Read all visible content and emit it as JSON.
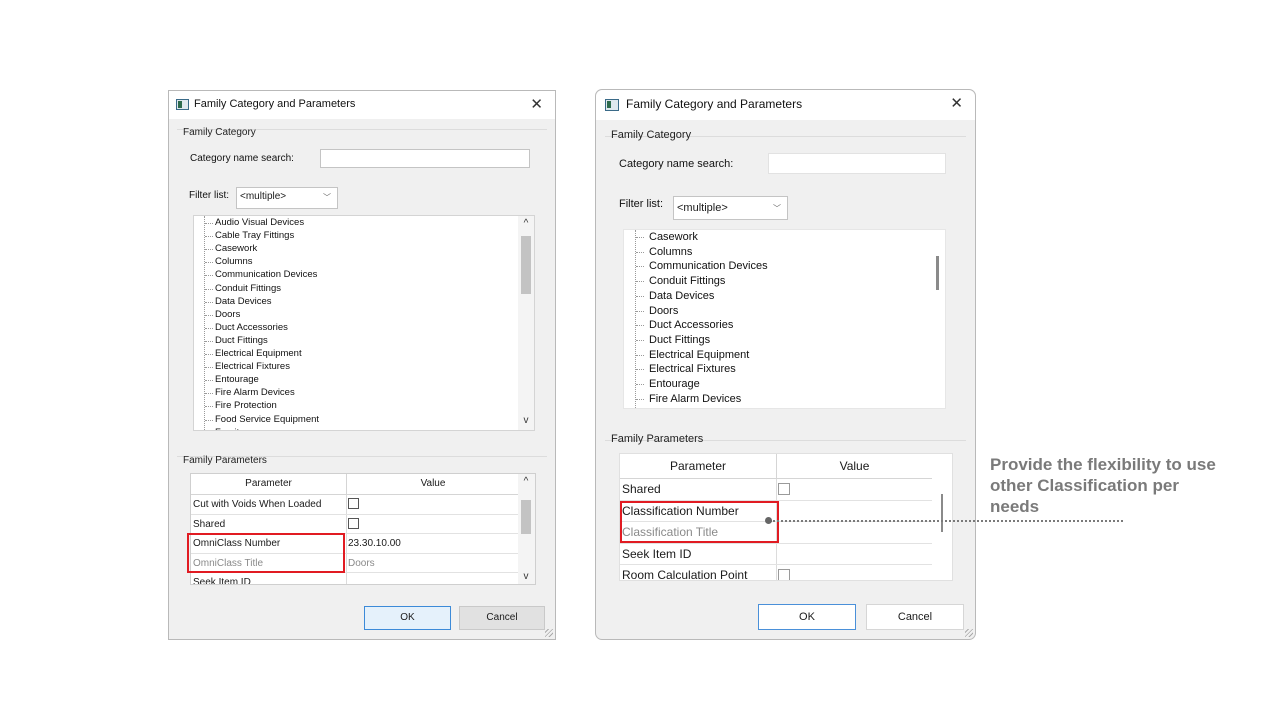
{
  "left_dialog": {
    "title": "Family Category and Parameters",
    "family_category_label": "Family Category",
    "category_search_label": "Category name search:",
    "category_search_value": "",
    "filter_label": "Filter list:",
    "filter_value": "<multiple>",
    "categories": [
      "Audio Visual Devices",
      "Cable Tray Fittings",
      "Casework",
      "Columns",
      "Communication Devices",
      "Conduit Fittings",
      "Data Devices",
      "Doors",
      "Duct Accessories",
      "Duct Fittings",
      "Electrical Equipment",
      "Electrical Fixtures",
      "Entourage",
      "Fire Alarm Devices",
      "Fire Protection",
      "Food Service Equipment",
      "Furniture"
    ],
    "family_parameters_label": "Family Parameters",
    "columns": [
      "Parameter",
      "Value"
    ],
    "rows": [
      {
        "parameter": "Cut with Voids When Loaded",
        "value": "",
        "checkbox": true,
        "checked": false
      },
      {
        "parameter": "Shared",
        "value": "",
        "checkbox": true,
        "checked": false
      },
      {
        "parameter": "OmniClass Number",
        "value": "23.30.10.00",
        "checkbox": false
      },
      {
        "parameter": "OmniClass Title",
        "value": "Doors",
        "checkbox": false,
        "greyed": true
      },
      {
        "parameter": "Seek Item ID",
        "value": "",
        "checkbox": false
      }
    ],
    "ok_label": "OK",
    "cancel_label": "Cancel"
  },
  "right_dialog": {
    "title": "Family Category and Parameters",
    "family_category_label": "Family Category",
    "category_search_label": "Category name search:",
    "category_search_value": "",
    "filter_label": "Filter list:",
    "filter_value": "<multiple>",
    "categories": [
      "Casework",
      "Columns",
      "Communication Devices",
      "Conduit Fittings",
      "Data Devices",
      "Doors",
      "Duct Accessories",
      "Duct Fittings",
      "Electrical Equipment",
      "Electrical Fixtures",
      "Entourage",
      "Fire Alarm Devices"
    ],
    "family_parameters_label": "Family Parameters",
    "columns": [
      "Parameter",
      "Value"
    ],
    "rows": [
      {
        "parameter": "Shared",
        "value": "",
        "checkbox": true,
        "checked": false
      },
      {
        "parameter": "Classification Number",
        "value": "",
        "checkbox": false
      },
      {
        "parameter": "Classification Title",
        "value": "",
        "checkbox": false,
        "greyed": true
      },
      {
        "parameter": "Seek Item ID",
        "value": "",
        "checkbox": false
      },
      {
        "parameter": "Room Calculation Point",
        "value": "",
        "checkbox": true,
        "checked": false
      }
    ],
    "ok_label": "OK",
    "cancel_label": "Cancel"
  },
  "callout": {
    "text": "Provide the flexibility to use other Classification per needs"
  },
  "colors": {
    "highlight": "#e11b22",
    "callout_text": "#7a7a7a",
    "ok_border": "#3c8ad8"
  },
  "icons": [
    "app-icon",
    "close-icon",
    "chevron-down-icon",
    "scroll-up-icon",
    "scroll-down-icon"
  ]
}
